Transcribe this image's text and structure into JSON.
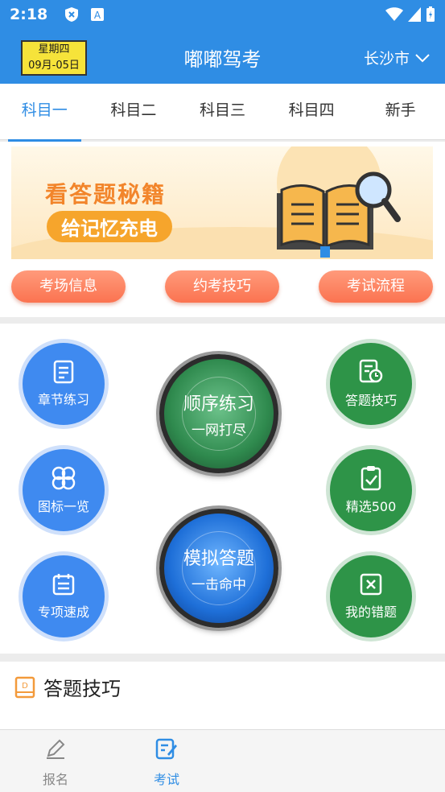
{
  "status": {
    "time": "2:18"
  },
  "header": {
    "weekday": "星期四",
    "date": "09月-05日",
    "title": "嘟嘟驾考",
    "city": "长沙市"
  },
  "tabs": [
    {
      "label": "科目一",
      "active": true
    },
    {
      "label": "科目二"
    },
    {
      "label": "科目三"
    },
    {
      "label": "科目四"
    },
    {
      "label": "新手"
    }
  ],
  "banner": {
    "line1": "看答题秘籍",
    "line2": "给记忆充电"
  },
  "pills": [
    "考场信息",
    "约考技巧",
    "考试流程"
  ],
  "menu": {
    "chapter": "章节练习",
    "icons": "图标一览",
    "special": "专项速成",
    "tips": "答题技巧",
    "selected": "精选500",
    "wrong": "我的错题",
    "order": {
      "title": "顺序练习",
      "sub": "一网打尽"
    },
    "mock": {
      "title": "模拟答题",
      "sub": "一击命中"
    }
  },
  "section": {
    "title": "答题技巧"
  },
  "bottom_nav": [
    {
      "label": "报名"
    },
    {
      "label": "考试",
      "active": true
    },
    {
      "label": ""
    }
  ],
  "colors": {
    "primary": "#2f8de4",
    "green": "#2e9448",
    "blue": "#3f8af0",
    "orange": "#fb7350"
  }
}
